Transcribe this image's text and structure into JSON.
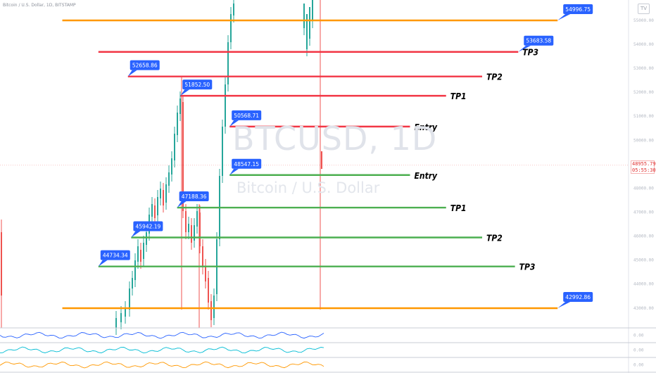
{
  "header": {
    "symbol_text": "Bitcoin / U.S. Dollar, 1D, BITSTAMP"
  },
  "watermark": {
    "ticker": "BTCUSD, 1D",
    "name": "Bitcoin / U.S. Dollar"
  },
  "current_price": {
    "value": "48955.79",
    "countdown": "05:55:30",
    "color": "#e03131"
  },
  "logo": {
    "icon": "tradingview-logo-icon",
    "text": "TV"
  },
  "chart_data": {
    "type": "candlestick",
    "yrange": [
      42000,
      55500
    ],
    "price_axis_ticks": [
      "55000.00",
      "54000.00",
      "53000.00",
      "52000.00",
      "51000.00",
      "50000.00",
      "49000.00",
      "48000.00",
      "47000.00",
      "46000.00",
      "45000.00",
      "44000.00",
      "43000.00"
    ],
    "levels": [
      {
        "price": 54996.75,
        "label": "54996.75",
        "color": "#ff9800",
        "tag": "",
        "x_start": 0.095,
        "x_end": 0.85,
        "flag_x": 0.85
      },
      {
        "price": 53683.58,
        "label": "53683.58",
        "color": "#f23645",
        "tag": "TP3",
        "x_start": 0.15,
        "x_end": 0.79,
        "flag_x": 0.79
      },
      {
        "price": 52658.86,
        "label": "52658.86",
        "color": "#f23645",
        "tag": "TP2",
        "x_start": 0.195,
        "x_end": 0.735,
        "flag_x": 0.195
      },
      {
        "price": 51852.5,
        "label": "51852.50",
        "color": "#f23645",
        "tag": "TP1",
        "x_start": 0.275,
        "x_end": 0.68,
        "flag_x": 0.275
      },
      {
        "price": 50568.71,
        "label": "50568.71",
        "color": "#f23645",
        "tag": "Entry",
        "x_start": 0.35,
        "x_end": 0.625,
        "flag_x": 0.35
      },
      {
        "price": 48547.15,
        "label": "48547.15",
        "color": "#4caf50",
        "tag": "Entry",
        "x_start": 0.35,
        "x_end": 0.625,
        "flag_x": 0.35
      },
      {
        "price": 47188.36,
        "label": "47188.36",
        "color": "#4caf50",
        "tag": "TP1",
        "x_start": 0.27,
        "x_end": 0.68,
        "flag_x": 0.27
      },
      {
        "price": 45942.19,
        "label": "45942.19",
        "color": "#4caf50",
        "tag": "TP2",
        "x_start": 0.2,
        "x_end": 0.735,
        "flag_x": 0.2
      },
      {
        "price": 44734.34,
        "label": "44734.34",
        "color": "#4caf50",
        "tag": "TP3",
        "x_start": 0.15,
        "x_end": 0.785,
        "flag_x": 0.15
      },
      {
        "price": 42992.86,
        "label": "42992.86",
        "color": "#ff9800",
        "tag": "",
        "x_start": 0.095,
        "x_end": 0.85,
        "flag_x": 0.85
      }
    ],
    "indicator_panels": [
      {
        "color": "#2962ff",
        "value_label": "0.00"
      },
      {
        "color": "#00bcd4",
        "value_label": "0.00"
      },
      {
        "color": "#ff9800",
        "value_label": "0.00"
      }
    ]
  }
}
